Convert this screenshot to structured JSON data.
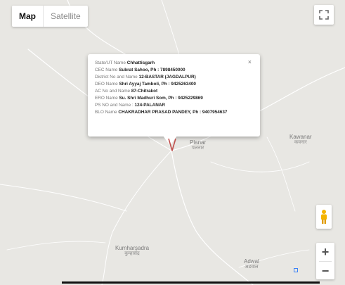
{
  "map_type": {
    "active": "Map",
    "inactive": "Satellite"
  },
  "popup": {
    "close_label": "×",
    "rows": [
      {
        "label": "State/UT Name ",
        "value": "Chhattisgarh"
      },
      {
        "label": "CEC Name ",
        "value": "Subrat Sahoo, Ph : 7898450000"
      },
      {
        "label": "District No and Name ",
        "value": "12-BASTAR (JAGDALPUR)"
      },
      {
        "label": "DEO Name ",
        "value": "Shri Ayyaj Tamboli, Ph : 9425263400"
      },
      {
        "label": "AC No and Name ",
        "value": "87-Chitrakot"
      },
      {
        "label": "ERO Name ",
        "value": "Su. Shri Madhuri Som, Ph : 9425229869"
      },
      {
        "label": "PS NO and Name : ",
        "value": "124-PALANAR"
      },
      {
        "label": "BLO Name ",
        "value": "CHAKRADHAR PRASAD PANDEY, Ph : 9407954637"
      }
    ]
  },
  "places": {
    "planar": {
      "name": "Planar",
      "local": "पलनार"
    },
    "kawanar": {
      "name": "Kawanar",
      "local": "कवनार"
    },
    "kumharsadra": {
      "name": "Kumharsadra",
      "local": "कुम्हार्सद्र"
    },
    "adwal": {
      "name": "Adwal",
      "local": "अडवाल"
    }
  },
  "controls": {
    "zoom_in": "+",
    "zoom_out": "−"
  },
  "colors": {
    "map_background": "#e8e7e3",
    "road": "#ffffff",
    "marker": "#c0504d"
  },
  "icons": {
    "fullscreen": "fullscreen-icon",
    "pegman": "pegman-icon",
    "marker": "map-pin-icon",
    "close": "close-icon"
  }
}
